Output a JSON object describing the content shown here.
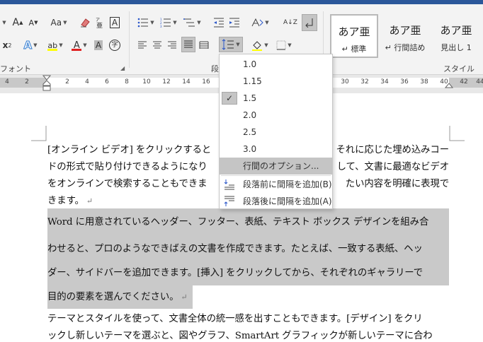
{
  "ribbon": {
    "font_group_label": "フォント",
    "paragraph_group_label": "段",
    "styles_group_label": "スタイル",
    "font_size_up": "A",
    "font_size_down": "A",
    "change_case": "Aa",
    "subscript": "x",
    "subscript_mark": "2",
    "text_effects": "A",
    "highlight": "ab",
    "font_color": "A",
    "char_shading": "A",
    "enclosed_char": "字",
    "char_border": "A",
    "sort": "A↓Z",
    "styles": [
      {
        "sample": "あア亜",
        "name": "↵ 標準"
      },
      {
        "sample": "あア亜",
        "name": "↵ 行間詰め"
      },
      {
        "sample": "あア亜",
        "name": "見出し 1"
      }
    ]
  },
  "ruler": {
    "numbers": [
      "4",
      "2",
      "2",
      "4",
      "6",
      "8",
      "10",
      "12",
      "14",
      "16",
      "30",
      "32",
      "34",
      "36",
      "38",
      "40",
      "42",
      "44"
    ]
  },
  "dropdown": {
    "items": [
      "1.0",
      "1.15",
      "1.5",
      "2.0",
      "2.5",
      "3.0"
    ],
    "checked": "1.5",
    "check_glyph": "✓",
    "options": "行間のオプション...",
    "add_before": "段落前に間隔を追加(B)",
    "add_after": "段落後に間隔を追加(A)"
  },
  "document": {
    "para1": [
      "[オンライン ビデオ] をクリックすると",
      "ドの形式で貼り付けできるようになり",
      "をオンラインで検索することもできま",
      "きます。"
    ],
    "para1_right": [
      "それに応じた埋め込みコー",
      "して、文書に最適なビデオ",
      "たい内容を明確に表現で"
    ],
    "para2": [
      "Word に用意されているヘッダー、フッター、表紙、テキスト ボックス デザインを組み合",
      "わせると、プロのようなできばえの文書を作成できます。たとえば、一致する表紙、ヘッ",
      "ダー、サイドバーを追加できます。[挿入] をクリックしてから、それぞれのギャラリーで",
      "目的の要素を選んでください。"
    ],
    "para3": [
      "テーマとスタイルを使って、文書全体の統一感を出すこともできます。[デザイン] をクリ",
      "ックし新しいテーマを選ぶと、図やグラフ、SmartArt グラフィックが新しいテーマに合わ"
    ],
    "paragraph_mark": "↵"
  }
}
